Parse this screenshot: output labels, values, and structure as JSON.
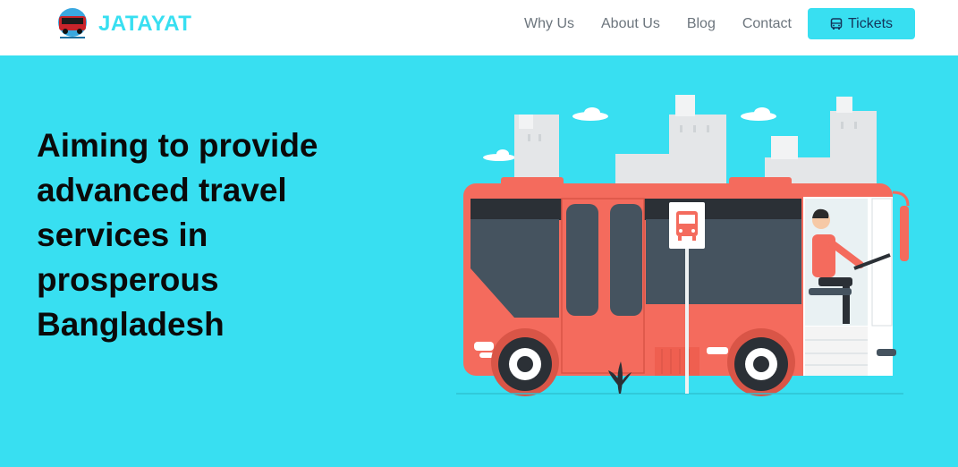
{
  "navbar": {
    "brand_name": "JATAYAT",
    "links": [
      "Why Us",
      "About Us",
      "Blog",
      "Contact"
    ],
    "tickets_label": "Tickets"
  },
  "hero": {
    "title": "Aiming to provide advanced travel services in prosperous Bangladesh"
  },
  "colors": {
    "accent": "#38dff1",
    "bus_body": "#f46b5d",
    "window": "#45535f",
    "nav_text": "#6c757d"
  },
  "icons": [
    "bus-logo-icon",
    "bus-icon",
    "bus-stop-sign-icon"
  ]
}
